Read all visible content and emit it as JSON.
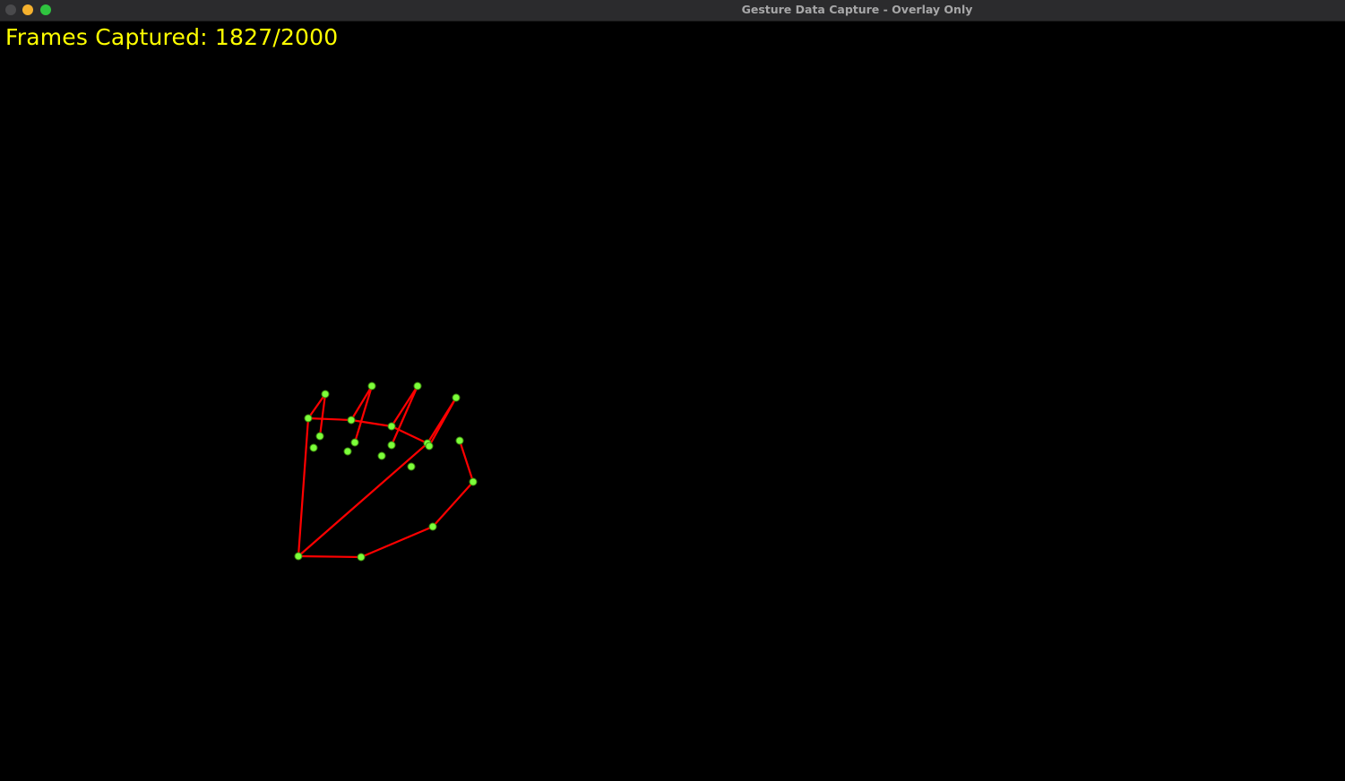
{
  "window": {
    "title": "Gesture Data Capture - Overlay Only"
  },
  "overlay": {
    "frames_label": "Frames Captured: 1827/2000",
    "frames_captured": 1827,
    "frames_total": 2000,
    "colors": {
      "text": "#ffff00",
      "skeleton_line": "#ff0000",
      "landmark_point": "#7cff3a",
      "background": "#000000"
    },
    "landmark_count": 21
  }
}
